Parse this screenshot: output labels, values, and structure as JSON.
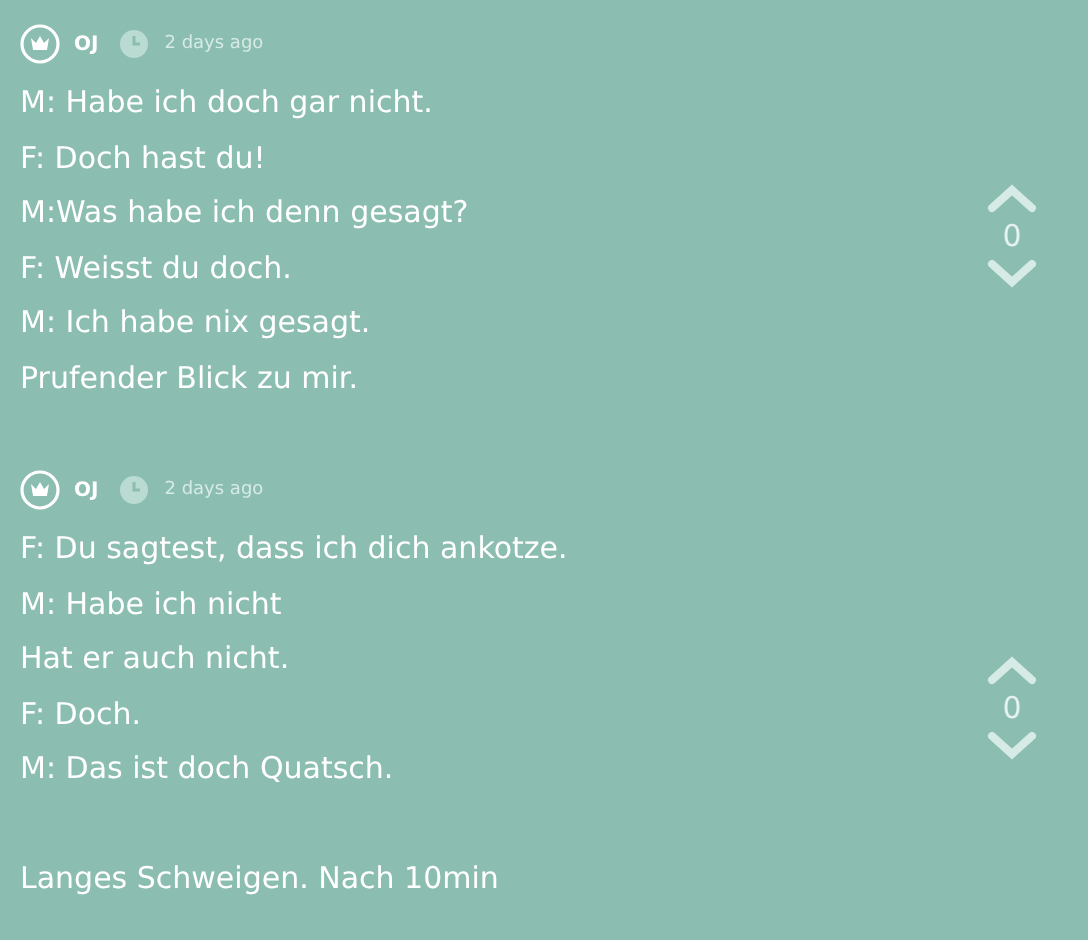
{
  "posts": [
    {
      "author": "OJ",
      "time": "2 days ago",
      "paragraphs": [
        [
          "M: Habe ich doch gar nicht.",
          "F: Doch hast du!",
          "M:Was habe ich denn gesagt?",
          "F: Weisst du doch.",
          "M: Ich habe nix gesagt.",
          "Prufender Blick zu mir."
        ]
      ],
      "score": "0"
    },
    {
      "author": "OJ",
      "time": "2 days ago",
      "paragraphs": [
        [
          "F: Du sagtest, dass ich dich ankotze.",
          "M: Habe ich nicht",
          "Hat er auch nicht.",
          "F: Doch.",
          "M: Das ist doch Quatsch."
        ],
        [
          "Langes Schweigen. Nach 10min"
        ]
      ],
      "score": "0"
    }
  ]
}
